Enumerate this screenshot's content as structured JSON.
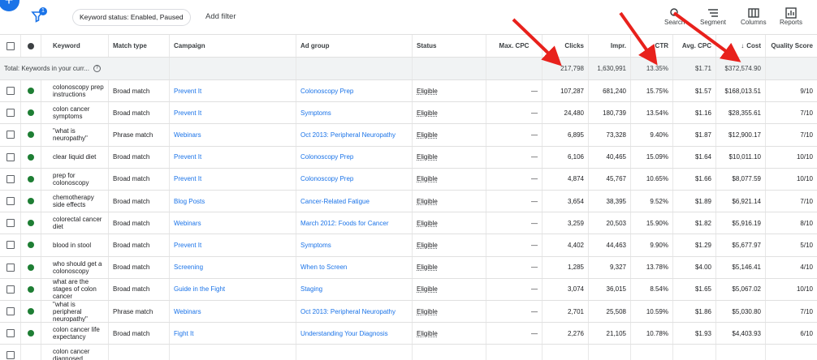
{
  "toolbar": {
    "filter_badge": "1",
    "chip": "Keyword status: Enabled, Paused",
    "add_filter": "Add filter",
    "tools": [
      {
        "label": "Search",
        "icon": "search-icon"
      },
      {
        "label": "Segment",
        "icon": "segment-icon"
      },
      {
        "label": "Columns",
        "icon": "columns-icon"
      },
      {
        "label": "Reports",
        "icon": "reports-icon"
      }
    ]
  },
  "headers": {
    "keyword": "Keyword",
    "match_type": "Match type",
    "campaign": "Campaign",
    "ad_group": "Ad group",
    "status": "Status",
    "max_cpc": "Max. CPC",
    "clicks": "Clicks",
    "impr": "Impr.",
    "ctr": "CTR",
    "avg_cpc": "Avg. CPC",
    "cost": "Cost",
    "cost_sort_arrow": "↓",
    "quality_score": "Quality Score"
  },
  "total": {
    "label": "Total: Keywords in your curr...",
    "clicks": "217,798",
    "impr": "1,630,991",
    "ctr": "13.35%",
    "avg_cpc": "$1.71",
    "cost": "$372,574.90"
  },
  "rows": [
    {
      "keyword": "colonoscopy prep instructions",
      "match": "Broad match",
      "campaign": "Prevent It",
      "ad_group": "Colonoscopy Prep",
      "status": "Eligible",
      "max_cpc": "—",
      "clicks": "107,287",
      "impr": "681,240",
      "ctr": "15.75%",
      "avg_cpc": "$1.57",
      "cost": "$168,013.51",
      "qs": "9/10"
    },
    {
      "keyword": "colon cancer symptoms",
      "match": "Broad match",
      "campaign": "Prevent It",
      "ad_group": "Symptoms",
      "status": "Eligible",
      "max_cpc": "—",
      "clicks": "24,480",
      "impr": "180,739",
      "ctr": "13.54%",
      "avg_cpc": "$1.16",
      "cost": "$28,355.61",
      "qs": "7/10"
    },
    {
      "keyword": "\"what is neuropathy\"",
      "match": "Phrase match",
      "campaign": "Webinars",
      "ad_group": "Oct 2013: Peripheral Neuropathy",
      "status": "Eligible",
      "max_cpc": "—",
      "clicks": "6,895",
      "impr": "73,328",
      "ctr": "9.40%",
      "avg_cpc": "$1.87",
      "cost": "$12,900.17",
      "qs": "7/10"
    },
    {
      "keyword": "clear liquid diet",
      "match": "Broad match",
      "campaign": "Prevent It",
      "ad_group": "Colonoscopy Prep",
      "status": "Eligible",
      "max_cpc": "—",
      "clicks": "6,106",
      "impr": "40,465",
      "ctr": "15.09%",
      "avg_cpc": "$1.64",
      "cost": "$10,011.10",
      "qs": "10/10"
    },
    {
      "keyword": "prep for colonoscopy",
      "match": "Broad match",
      "campaign": "Prevent It",
      "ad_group": "Colonoscopy Prep",
      "status": "Eligible",
      "max_cpc": "—",
      "clicks": "4,874",
      "impr": "45,767",
      "ctr": "10.65%",
      "avg_cpc": "$1.66",
      "cost": "$8,077.59",
      "qs": "10/10"
    },
    {
      "keyword": "chemotherapy side effects",
      "match": "Broad match",
      "campaign": "Blog Posts",
      "ad_group": "Cancer-Related Fatigue",
      "status": "Eligible",
      "max_cpc": "—",
      "clicks": "3,654",
      "impr": "38,395",
      "ctr": "9.52%",
      "avg_cpc": "$1.89",
      "cost": "$6,921.14",
      "qs": "7/10"
    },
    {
      "keyword": "colorectal cancer diet",
      "match": "Broad match",
      "campaign": "Webinars",
      "ad_group": "March 2012: Foods for Cancer",
      "status": "Eligible",
      "max_cpc": "—",
      "clicks": "3,259",
      "impr": "20,503",
      "ctr": "15.90%",
      "avg_cpc": "$1.82",
      "cost": "$5,916.19",
      "qs": "8/10"
    },
    {
      "keyword": "blood in stool",
      "match": "Broad match",
      "campaign": "Prevent It",
      "ad_group": "Symptoms",
      "status": "Eligible",
      "max_cpc": "—",
      "clicks": "4,402",
      "impr": "44,463",
      "ctr": "9.90%",
      "avg_cpc": "$1.29",
      "cost": "$5,677.97",
      "qs": "5/10"
    },
    {
      "keyword": "who should get a colonoscopy",
      "match": "Broad match",
      "campaign": "Screening",
      "ad_group": "When to Screen",
      "status": "Eligible",
      "max_cpc": "—",
      "clicks": "1,285",
      "impr": "9,327",
      "ctr": "13.78%",
      "avg_cpc": "$4.00",
      "cost": "$5,146.41",
      "qs": "4/10"
    },
    {
      "keyword": "what are the stages of colon cancer",
      "match": "Broad match",
      "campaign": "Guide in the Fight",
      "ad_group": "Staging",
      "status": "Eligible",
      "max_cpc": "—",
      "clicks": "3,074",
      "impr": "36,015",
      "ctr": "8.54%",
      "avg_cpc": "$1.65",
      "cost": "$5,067.02",
      "qs": "10/10"
    },
    {
      "keyword": "\"what is peripheral neuropathy\"",
      "match": "Phrase match",
      "campaign": "Webinars",
      "ad_group": "Oct 2013: Peripheral Neuropathy",
      "status": "Eligible",
      "max_cpc": "—",
      "clicks": "2,701",
      "impr": "25,508",
      "ctr": "10.59%",
      "avg_cpc": "$1.86",
      "cost": "$5,030.80",
      "qs": "7/10"
    },
    {
      "keyword": "colon cancer life expectancy",
      "match": "Broad match",
      "campaign": "Fight It",
      "ad_group": "Understanding Your Diagnosis",
      "status": "Eligible",
      "max_cpc": "—",
      "clicks": "2,276",
      "impr": "21,105",
      "ctr": "10.78%",
      "avg_cpc": "$1.93",
      "cost": "$4,403.93",
      "qs": "6/10"
    },
    {
      "keyword": "colon cancer diagnosed",
      "match": "",
      "campaign": "",
      "ad_group": "",
      "status": "",
      "max_cpc": "",
      "clicks": "",
      "impr": "",
      "ctr": "",
      "avg_cpc": "",
      "cost": "",
      "qs": ""
    }
  ],
  "colors": {
    "accent": "#1a73e8",
    "eligible_dot": "#1e7e34",
    "annotation_arrow": "#e8211c"
  }
}
